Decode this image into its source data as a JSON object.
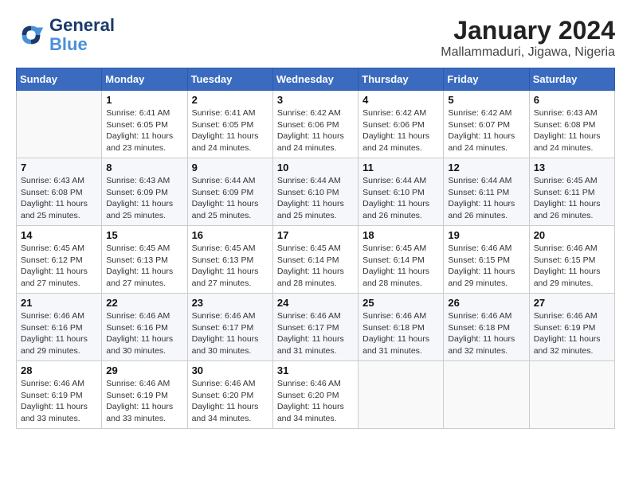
{
  "header": {
    "logo_line1": "General",
    "logo_line2": "Blue",
    "title": "January 2024",
    "subtitle": "Mallammaduri, Jigawa, Nigeria"
  },
  "weekdays": [
    "Sunday",
    "Monday",
    "Tuesday",
    "Wednesday",
    "Thursday",
    "Friday",
    "Saturday"
  ],
  "weeks": [
    [
      {
        "day": "",
        "info": ""
      },
      {
        "day": "1",
        "info": "Sunrise: 6:41 AM\nSunset: 6:05 PM\nDaylight: 11 hours\nand 23 minutes."
      },
      {
        "day": "2",
        "info": "Sunrise: 6:41 AM\nSunset: 6:05 PM\nDaylight: 11 hours\nand 24 minutes."
      },
      {
        "day": "3",
        "info": "Sunrise: 6:42 AM\nSunset: 6:06 PM\nDaylight: 11 hours\nand 24 minutes."
      },
      {
        "day": "4",
        "info": "Sunrise: 6:42 AM\nSunset: 6:06 PM\nDaylight: 11 hours\nand 24 minutes."
      },
      {
        "day": "5",
        "info": "Sunrise: 6:42 AM\nSunset: 6:07 PM\nDaylight: 11 hours\nand 24 minutes."
      },
      {
        "day": "6",
        "info": "Sunrise: 6:43 AM\nSunset: 6:08 PM\nDaylight: 11 hours\nand 24 minutes."
      }
    ],
    [
      {
        "day": "7",
        "info": "Sunrise: 6:43 AM\nSunset: 6:08 PM\nDaylight: 11 hours\nand 25 minutes."
      },
      {
        "day": "8",
        "info": "Sunrise: 6:43 AM\nSunset: 6:09 PM\nDaylight: 11 hours\nand 25 minutes."
      },
      {
        "day": "9",
        "info": "Sunrise: 6:44 AM\nSunset: 6:09 PM\nDaylight: 11 hours\nand 25 minutes."
      },
      {
        "day": "10",
        "info": "Sunrise: 6:44 AM\nSunset: 6:10 PM\nDaylight: 11 hours\nand 25 minutes."
      },
      {
        "day": "11",
        "info": "Sunrise: 6:44 AM\nSunset: 6:10 PM\nDaylight: 11 hours\nand 26 minutes."
      },
      {
        "day": "12",
        "info": "Sunrise: 6:44 AM\nSunset: 6:11 PM\nDaylight: 11 hours\nand 26 minutes."
      },
      {
        "day": "13",
        "info": "Sunrise: 6:45 AM\nSunset: 6:11 PM\nDaylight: 11 hours\nand 26 minutes."
      }
    ],
    [
      {
        "day": "14",
        "info": "Sunrise: 6:45 AM\nSunset: 6:12 PM\nDaylight: 11 hours\nand 27 minutes."
      },
      {
        "day": "15",
        "info": "Sunrise: 6:45 AM\nSunset: 6:13 PM\nDaylight: 11 hours\nand 27 minutes."
      },
      {
        "day": "16",
        "info": "Sunrise: 6:45 AM\nSunset: 6:13 PM\nDaylight: 11 hours\nand 27 minutes."
      },
      {
        "day": "17",
        "info": "Sunrise: 6:45 AM\nSunset: 6:14 PM\nDaylight: 11 hours\nand 28 minutes."
      },
      {
        "day": "18",
        "info": "Sunrise: 6:45 AM\nSunset: 6:14 PM\nDaylight: 11 hours\nand 28 minutes."
      },
      {
        "day": "19",
        "info": "Sunrise: 6:46 AM\nSunset: 6:15 PM\nDaylight: 11 hours\nand 29 minutes."
      },
      {
        "day": "20",
        "info": "Sunrise: 6:46 AM\nSunset: 6:15 PM\nDaylight: 11 hours\nand 29 minutes."
      }
    ],
    [
      {
        "day": "21",
        "info": "Sunrise: 6:46 AM\nSunset: 6:16 PM\nDaylight: 11 hours\nand 29 minutes."
      },
      {
        "day": "22",
        "info": "Sunrise: 6:46 AM\nSunset: 6:16 PM\nDaylight: 11 hours\nand 30 minutes."
      },
      {
        "day": "23",
        "info": "Sunrise: 6:46 AM\nSunset: 6:17 PM\nDaylight: 11 hours\nand 30 minutes."
      },
      {
        "day": "24",
        "info": "Sunrise: 6:46 AM\nSunset: 6:17 PM\nDaylight: 11 hours\nand 31 minutes."
      },
      {
        "day": "25",
        "info": "Sunrise: 6:46 AM\nSunset: 6:18 PM\nDaylight: 11 hours\nand 31 minutes."
      },
      {
        "day": "26",
        "info": "Sunrise: 6:46 AM\nSunset: 6:18 PM\nDaylight: 11 hours\nand 32 minutes."
      },
      {
        "day": "27",
        "info": "Sunrise: 6:46 AM\nSunset: 6:19 PM\nDaylight: 11 hours\nand 32 minutes."
      }
    ],
    [
      {
        "day": "28",
        "info": "Sunrise: 6:46 AM\nSunset: 6:19 PM\nDaylight: 11 hours\nand 33 minutes."
      },
      {
        "day": "29",
        "info": "Sunrise: 6:46 AM\nSunset: 6:19 PM\nDaylight: 11 hours\nand 33 minutes."
      },
      {
        "day": "30",
        "info": "Sunrise: 6:46 AM\nSunset: 6:20 PM\nDaylight: 11 hours\nand 34 minutes."
      },
      {
        "day": "31",
        "info": "Sunrise: 6:46 AM\nSunset: 6:20 PM\nDaylight: 11 hours\nand 34 minutes."
      },
      {
        "day": "",
        "info": ""
      },
      {
        "day": "",
        "info": ""
      },
      {
        "day": "",
        "info": ""
      }
    ]
  ]
}
